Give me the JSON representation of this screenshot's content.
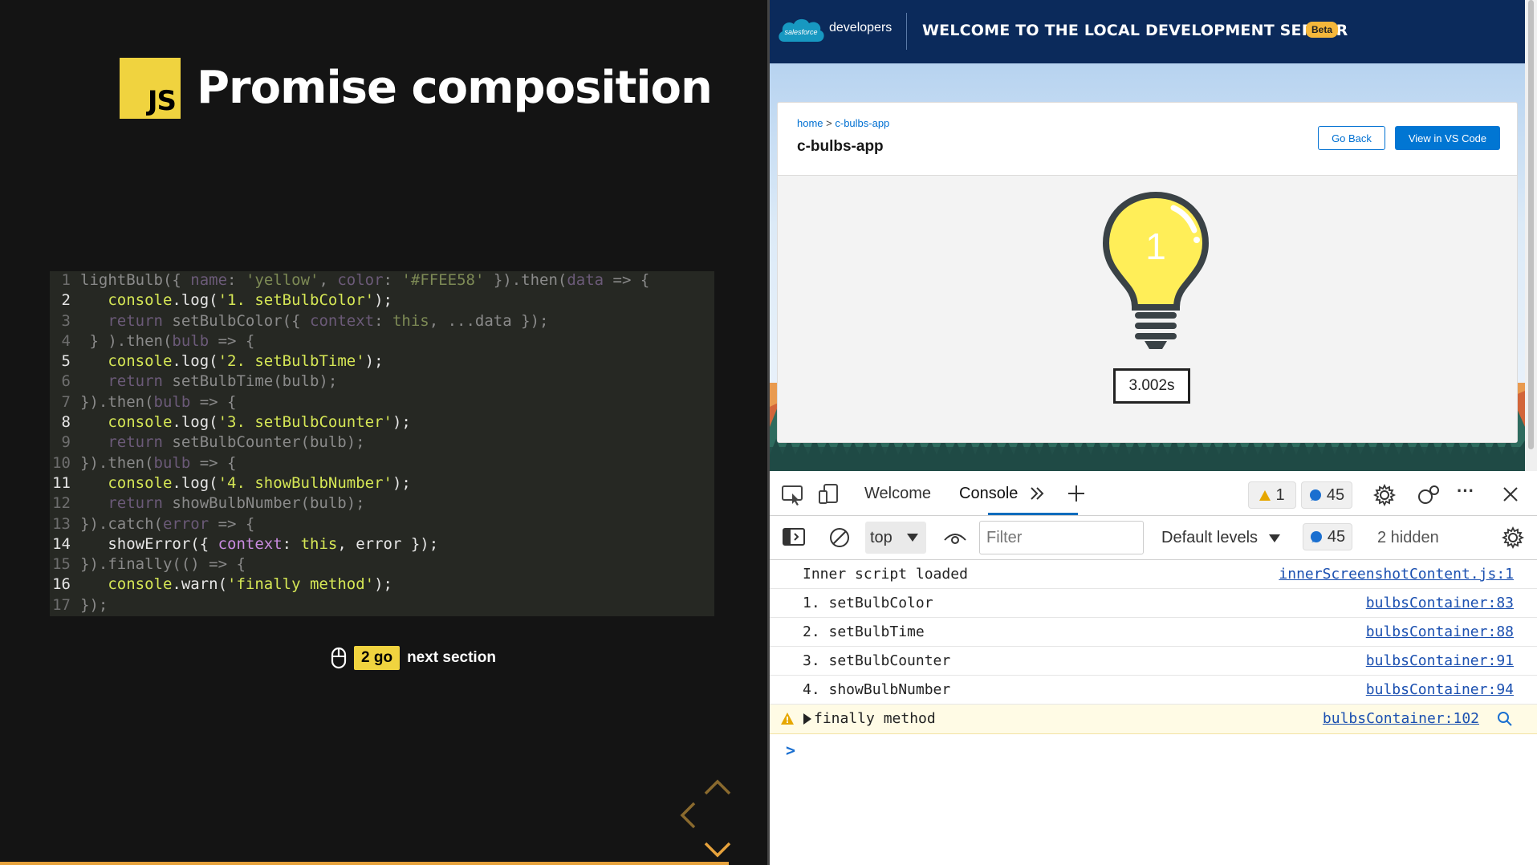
{
  "slide": {
    "logo_text": "JS",
    "title": "Promise composition",
    "code": [
      {
        "n": "1",
        "hi": false,
        "parts": [
          [
            "t",
            "lightBulb({ "
          ],
          [
            "k",
            "name"
          ],
          [
            "t",
            ": "
          ],
          [
            "s",
            "'yellow'"
          ],
          [
            "t",
            ", "
          ],
          [
            "k",
            "color"
          ],
          [
            "t",
            ": "
          ],
          [
            "s",
            "'#FFEE58'"
          ],
          [
            "t",
            " }).then("
          ],
          [
            "k",
            "data"
          ],
          [
            "t",
            " => {"
          ]
        ]
      },
      {
        "n": "2",
        "hi": true,
        "parts": [
          [
            "t",
            "   "
          ],
          [
            "s",
            "console"
          ],
          [
            "t",
            ".log("
          ],
          [
            "s",
            "'1. setBulbColor'"
          ],
          [
            "t",
            ");"
          ]
        ]
      },
      {
        "n": "3",
        "hi": false,
        "parts": [
          [
            "t",
            "   "
          ],
          [
            "k",
            "return"
          ],
          [
            "t",
            " setBulbColor({ "
          ],
          [
            "k",
            "context"
          ],
          [
            "t",
            ": "
          ],
          [
            "s",
            "this"
          ],
          [
            "t",
            ", ...data });"
          ]
        ]
      },
      {
        "n": "4",
        "hi": false,
        "parts": [
          [
            "t",
            " } ).then("
          ],
          [
            "k",
            "bulb"
          ],
          [
            "t",
            " => {"
          ]
        ]
      },
      {
        "n": "5",
        "hi": true,
        "parts": [
          [
            "t",
            "   "
          ],
          [
            "s",
            "console"
          ],
          [
            "t",
            ".log("
          ],
          [
            "s",
            "'2. setBulbTime'"
          ],
          [
            "t",
            ");"
          ]
        ]
      },
      {
        "n": "6",
        "hi": false,
        "parts": [
          [
            "t",
            "   "
          ],
          [
            "k",
            "return"
          ],
          [
            "t",
            " setBulbTime(bulb);"
          ]
        ]
      },
      {
        "n": "7",
        "hi": false,
        "parts": [
          [
            "t",
            "}).then("
          ],
          [
            "k",
            "bulb"
          ],
          [
            "t",
            " => {"
          ]
        ]
      },
      {
        "n": "8",
        "hi": true,
        "parts": [
          [
            "t",
            "   "
          ],
          [
            "s",
            "console"
          ],
          [
            "t",
            ".log("
          ],
          [
            "s",
            "'3. setBulbCounter'"
          ],
          [
            "t",
            ");"
          ]
        ]
      },
      {
        "n": "9",
        "hi": false,
        "parts": [
          [
            "t",
            "   "
          ],
          [
            "k",
            "return"
          ],
          [
            "t",
            " setBulbCounter(bulb);"
          ]
        ]
      },
      {
        "n": "10",
        "hi": false,
        "parts": [
          [
            "t",
            "}).then("
          ],
          [
            "k",
            "bulb"
          ],
          [
            "t",
            " => {"
          ]
        ]
      },
      {
        "n": "11",
        "hi": true,
        "parts": [
          [
            "t",
            "   "
          ],
          [
            "s",
            "console"
          ],
          [
            "t",
            ".log("
          ],
          [
            "s",
            "'4. showBulbNumber'"
          ],
          [
            "t",
            ");"
          ]
        ]
      },
      {
        "n": "12",
        "hi": false,
        "parts": [
          [
            "t",
            "   "
          ],
          [
            "k",
            "return"
          ],
          [
            "t",
            " showBulbNumber(bulb);"
          ]
        ]
      },
      {
        "n": "13",
        "hi": false,
        "parts": [
          [
            "t",
            "}).catch("
          ],
          [
            "k",
            "error"
          ],
          [
            "t",
            " => {"
          ]
        ]
      },
      {
        "n": "14",
        "hi": true,
        "parts": [
          [
            "t",
            "   showError({ "
          ],
          [
            "k",
            "context"
          ],
          [
            "t",
            ": "
          ],
          [
            "s",
            "this"
          ],
          [
            "t",
            ", error });"
          ]
        ]
      },
      {
        "n": "15",
        "hi": false,
        "parts": [
          [
            "t",
            "}).finally(() => {"
          ]
        ]
      },
      {
        "n": "16",
        "hi": true,
        "parts": [
          [
            "t",
            "   "
          ],
          [
            "s",
            "console"
          ],
          [
            "t",
            ".warn("
          ],
          [
            "s",
            "'finally method'"
          ],
          [
            "t",
            ");"
          ]
        ]
      },
      {
        "n": "17",
        "hi": false,
        "parts": [
          [
            "t",
            "});"
          ]
        ]
      }
    ],
    "go_badge": "2 go",
    "next_text": "next section"
  },
  "browser": {
    "logo_text": "salesforce",
    "developers": "developers",
    "header_title": "WELCOME TO THE LOCAL DEVELOPMENT SERVER",
    "beta": "Beta",
    "breadcrumb_home": "home",
    "breadcrumb_sep": " > ",
    "breadcrumb_current": "c-bulbs-app",
    "card_title": "c-bulbs-app",
    "go_back": "Go Back",
    "view_vscode": "View in VS Code",
    "bulb_number": "1",
    "bulb_color": "#FFEE58",
    "timer": "3.002s"
  },
  "devtools": {
    "tabs": [
      "Welcome",
      "Console"
    ],
    "active_tab": "Console",
    "warn_count": "1",
    "msg_count": "45",
    "context": "top",
    "filter_placeholder": "Filter",
    "levels": "Default levels",
    "msg_count2": "45",
    "hidden": "2 hidden",
    "logs": [
      {
        "msg": "Inner script loaded",
        "src": "innerScreenshotContent.js:1",
        "type": "log"
      },
      {
        "msg": "1. setBulbColor",
        "src": "bulbsContainer:83",
        "type": "log"
      },
      {
        "msg": "2. setBulbTime",
        "src": "bulbsContainer:88",
        "type": "log"
      },
      {
        "msg": "3. setBulbCounter",
        "src": "bulbsContainer:91",
        "type": "log"
      },
      {
        "msg": "4. showBulbNumber",
        "src": "bulbsContainer:94",
        "type": "log"
      },
      {
        "msg": "finally method",
        "src": "bulbsContainer:102",
        "type": "warn"
      }
    ]
  },
  "colors": {
    "accent_yellow": "#F0D33F",
    "salesforce_navy": "#0B2A5B",
    "sf_blue": "#0176D3"
  }
}
